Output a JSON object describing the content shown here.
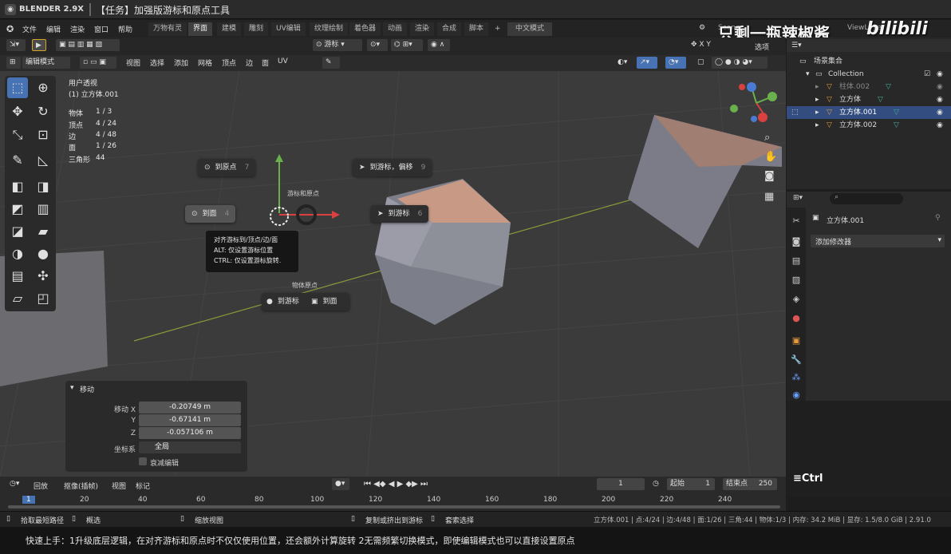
{
  "titlebar": {
    "app": "BLENDER 2.9X",
    "task": "【任务】加强版游标和原点工具"
  },
  "menu": [
    "文件",
    "编辑",
    "渲染",
    "窗口",
    "帮助"
  ],
  "workspaces": [
    "万物有灵",
    "界面",
    "建模",
    "雕刻",
    "UV编辑",
    "纹理绘制",
    "着色器",
    "动画",
    "渲染",
    "合成",
    "脚本"
  ],
  "lang_button": "中文模式",
  "scene_label": "Scene",
  "viewlayer_label": "ViewLayer",
  "options_label": "选项",
  "watermark": "只剩一瓶辣椒酱",
  "bilibili": "bilibili",
  "header3d": {
    "mode": "编辑模式",
    "menus": [
      "视图",
      "选择",
      "添加",
      "网格",
      "顶点",
      "边",
      "面",
      "UV"
    ],
    "pivot": "游标"
  },
  "viewinfo": {
    "view": "用户透视",
    "object": "(1) 立方体.001",
    "stats": [
      {
        "label": "物体",
        "value": "1 / 3"
      },
      {
        "label": "顶点",
        "value": "4 / 24"
      },
      {
        "label": "边",
        "value": "4 / 48"
      },
      {
        "label": "面",
        "value": "1 / 26"
      },
      {
        "label": "三角形",
        "value": "44"
      }
    ]
  },
  "pie": {
    "to_origin": {
      "label": "到原点",
      "num": "7"
    },
    "to_cursor_offset": {
      "label": "到游标，偏移",
      "num": "9"
    },
    "cursor_origin_title": "游标和原点",
    "to_face": {
      "label": "到面",
      "num": "4"
    },
    "to_cursor": {
      "label": "到游标",
      "num": "6"
    },
    "object_origin_title": "物体原点",
    "origin_to_cursor": "到游标",
    "origin_to_face": "到面"
  },
  "tooltip": [
    "对齐游标到/顶点/边/面",
    "ALT: 仅设置游标位置",
    "CTRL: 仅设置游标旋转."
  ],
  "move_panel": {
    "title": "移动",
    "x_label": "移动 X",
    "x": "-0.20749 m",
    "y_label": "Y",
    "y": "-0.67141 m",
    "z_label": "Z",
    "z": "-0.057106 m",
    "coord_label": "坐标系",
    "coord_value": "全局",
    "falloff": "衰减编辑"
  },
  "outliner": {
    "root": "场景集合",
    "collection": "Collection",
    "items": [
      "柱体.002",
      "立方体",
      "立方体.001",
      "立方体.002"
    ]
  },
  "properties": {
    "object": "立方体.001",
    "add_modifier": "添加修改器"
  },
  "ctrl_hint": "≡Ctrl",
  "timeline": {
    "menus": [
      "回放",
      "抠像(插帧)",
      "视图",
      "标记"
    ],
    "current": "1",
    "start_label": "起始",
    "start": "1",
    "end_label": "结束点",
    "end": "250",
    "ticks": [
      "1",
      "20",
      "40",
      "60",
      "80",
      "100",
      "120",
      "140",
      "160",
      "180",
      "200",
      "220",
      "240"
    ]
  },
  "statusbar": {
    "items": [
      "拾取最短路径",
      "概选",
      "缩放视图",
      "复制或挤出到游标",
      "套索选择"
    ],
    "right": "立方体.001 | 点:4/24 | 边:4/48 | 面:1/26 | 三角:44 | 物体:1/3 | 内存: 34.2 MiB | 显存: 1.5/8.0 GiB | 2.91.0"
  },
  "subtitle": "快速上手：1升级底层逻辑，在对齐游标和原点时不仅仅使用位置，还会额外计算旋转 2无需频繁切换模式，即使编辑模式也可以直接设置原点",
  "colors": {
    "accent": "#4772b3",
    "viewport": "#3b3b3b",
    "selected_face": "#c89a86"
  }
}
